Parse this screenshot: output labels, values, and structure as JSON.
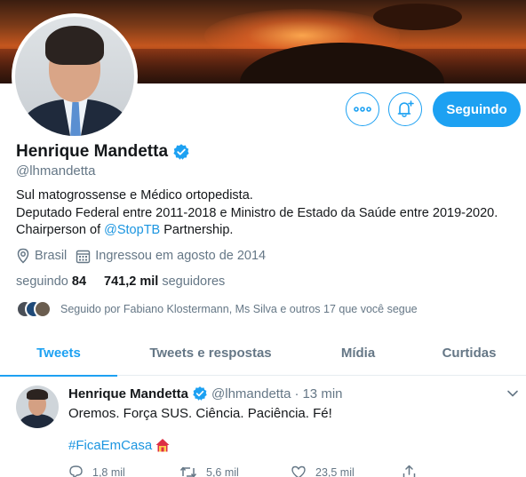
{
  "profile": {
    "name": "Henrique Mandetta",
    "handle": "@lhmandetta",
    "bio_line1": "Sul matogrossense e Médico ortopedista.",
    "bio_line2": "Deputado Federal entre 2011-2018 e Ministro de Estado da Saúde entre 2019-2020.",
    "bio_line3_prefix": "Chairperson of ",
    "bio_line3_link": "@StopTB",
    "bio_line3_suffix": " Partnership.",
    "location": "Brasil",
    "joined": "Ingressou em agosto de 2014",
    "following_label": "seguindo",
    "following_count": "84",
    "followers_count": "741,2 mil",
    "followers_label": "seguidores",
    "followed_by": "Seguido por Fabiano Klostermann, Ms Silva e outros 17 que você segue"
  },
  "actions": {
    "follow_label": "Seguindo",
    "more_icon": "more-icon",
    "bell_icon": "bell-plus-icon"
  },
  "tabs": [
    {
      "label": "Tweets",
      "active": true
    },
    {
      "label": "Tweets e respostas",
      "active": false
    },
    {
      "label": "Mídia",
      "active": false
    },
    {
      "label": "Curtidas",
      "active": false
    }
  ],
  "tweet": {
    "name": "Henrique Mandetta",
    "handle": "@lhmandetta",
    "separator": "·",
    "time": "13 min",
    "text": "Oremos. Força SUS. Ciência. Paciência. Fé!",
    "hashtag": "#FicaEmCasa",
    "replies": "1,8 mil",
    "retweets": "5,6 mil",
    "likes": "23,5 mil"
  },
  "colors": {
    "accent": "#1da1f2",
    "link": "#1b95e0",
    "secondary_text": "#657786"
  }
}
